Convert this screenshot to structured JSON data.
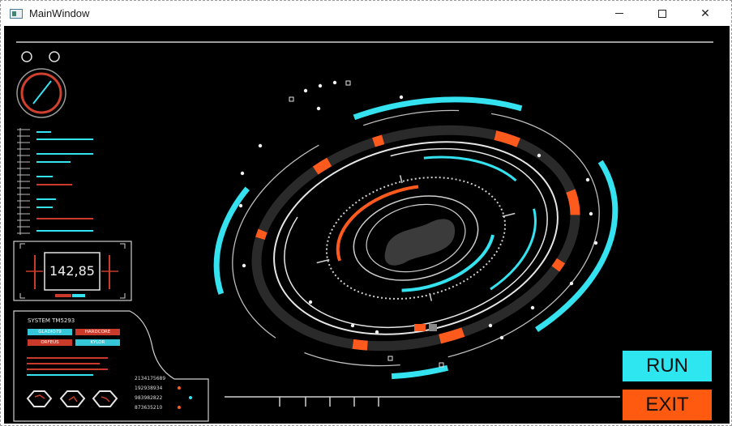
{
  "window": {
    "title": "MainWindow"
  },
  "hud": {
    "readout": "142,85",
    "system_title": "SYSTEM  TM5293",
    "tags": [
      "GLADIO79",
      "HARDCORE",
      "ORFEUS",
      "KYLOR"
    ],
    "numbers": [
      "2134175689",
      "192938934",
      "983982822",
      "873635210"
    ]
  },
  "buttons": {
    "run": "RUN",
    "exit": "EXIT"
  },
  "colors": {
    "cyan": "#35e2ef",
    "orange": "#ff5a1e",
    "red": "#c93a2b",
    "background": "#000000"
  }
}
